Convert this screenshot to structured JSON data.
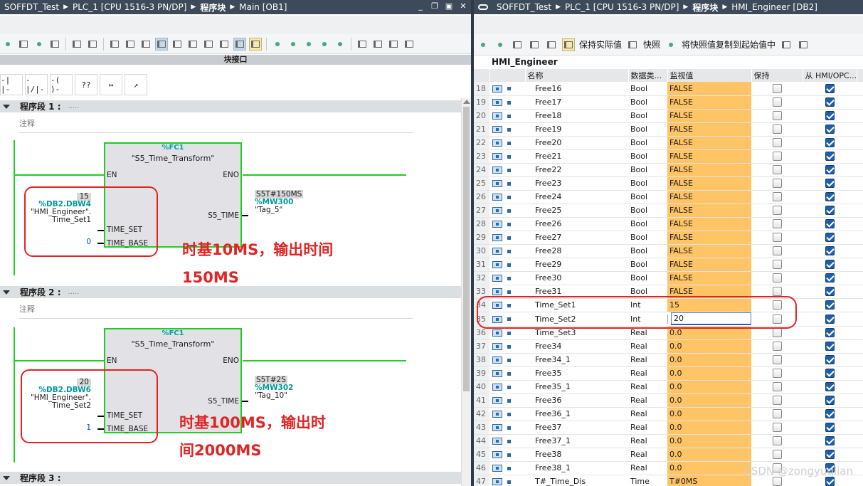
{
  "left_pane": {
    "breadcrumb": [
      "SOFFDT_Test",
      "PLC_1 [CPU 1516-3 PN/DP]",
      "程序块",
      "Main [OB1]"
    ],
    "block_interface_label": "块接口",
    "ladder_elements": [
      "-| |-",
      "-|/|-",
      "-( )-",
      "??",
      "↦",
      "↗"
    ],
    "networks": [
      {
        "label": "程序段 1 :",
        "dots": ".....",
        "comment": "注释",
        "fc_name": "%FC1",
        "fc_title": "\"S5_Time_Transform\"",
        "pin_en": "EN",
        "pin_eno": "ENO",
        "pin_time_set": "TIME_SET",
        "pin_time_base": "TIME_BASE",
        "pin_s5_time": "S5_TIME",
        "in_value": "15",
        "in_address": "%DB2.DBW4",
        "in_tag_line1": "\"HMI_Engineer\".",
        "in_tag_line2": "Time_Set1",
        "base_value": "0",
        "out_value": "S5T#150MS",
        "out_address": "%MW300",
        "out_tag": "\"Tag_5\"",
        "annotation_line1": "时基10MS，输出时间",
        "annotation_line2": "150MS"
      },
      {
        "label": "程序段 2 :",
        "dots": ".....",
        "comment": "注释",
        "fc_name": "%FC1",
        "fc_title": "\"S5_Time_Transform\"",
        "pin_en": "EN",
        "pin_eno": "ENO",
        "pin_time_set": "TIME_SET",
        "pin_time_base": "TIME_BASE",
        "pin_s5_time": "S5_TIME",
        "in_value": "20",
        "in_address": "%DB2.DBW6",
        "in_tag_line1": "\"HMI_Engineer\".",
        "in_tag_line2": "Time_Set2",
        "base_value": "1",
        "out_value": "S5T#2S",
        "out_address": "%MW302",
        "out_tag": "\"Tag_10\"",
        "annotation_line1": "时基100MS，输出时",
        "annotation_line2": "间2000MS"
      }
    ],
    "network3_label": "程序段 3 :"
  },
  "right_pane": {
    "breadcrumb": [
      "SOFFDT_Test",
      "PLC_1 [CPU 1516-3 PN/DP]",
      "程序块",
      "HMI_Engineer [DB2]"
    ],
    "toolbar_labels": [
      "保持实际值",
      "快照",
      "将快照值复制到起始值中"
    ],
    "db_name": "HMI_Engineer",
    "columns": [
      "名称",
      "数据类...",
      "监视值",
      "保持",
      "从 HMI/OPC..."
    ],
    "rows": [
      {
        "num": "18",
        "name": "Free16",
        "type": "Bool",
        "value": "FALSE"
      },
      {
        "num": "19",
        "name": "Free17",
        "type": "Bool",
        "value": "FALSE"
      },
      {
        "num": "20",
        "name": "Free18",
        "type": "Bool",
        "value": "FALSE"
      },
      {
        "num": "21",
        "name": "Free19",
        "type": "Bool",
        "value": "FALSE"
      },
      {
        "num": "22",
        "name": "Free20",
        "type": "Bool",
        "value": "FALSE"
      },
      {
        "num": "23",
        "name": "Free21",
        "type": "Bool",
        "value": "FALSE"
      },
      {
        "num": "24",
        "name": "Free22",
        "type": "Bool",
        "value": "FALSE"
      },
      {
        "num": "25",
        "name": "Free23",
        "type": "Bool",
        "value": "FALSE"
      },
      {
        "num": "26",
        "name": "Free24",
        "type": "Bool",
        "value": "FALSE"
      },
      {
        "num": "27",
        "name": "Free25",
        "type": "Bool",
        "value": "FALSE"
      },
      {
        "num": "28",
        "name": "Free26",
        "type": "Bool",
        "value": "FALSE"
      },
      {
        "num": "29",
        "name": "Free27",
        "type": "Bool",
        "value": "FALSE"
      },
      {
        "num": "30",
        "name": "Free28",
        "type": "Bool",
        "value": "FALSE"
      },
      {
        "num": "31",
        "name": "Free29",
        "type": "Bool",
        "value": "FALSE"
      },
      {
        "num": "32",
        "name": "Free30",
        "type": "Bool",
        "value": "FALSE"
      },
      {
        "num": "33",
        "name": "Free31",
        "type": "Bool",
        "value": "FALSE"
      },
      {
        "num": "34",
        "name": "Time_Set1",
        "type": "Int",
        "value": "15"
      },
      {
        "num": "35",
        "name": "Time_Set2",
        "type": "Int",
        "value": "20"
      },
      {
        "num": "36",
        "name": "Time_Set3",
        "type": "Real",
        "value": "0.0"
      },
      {
        "num": "37",
        "name": "Free34",
        "type": "Real",
        "value": "0.0"
      },
      {
        "num": "38",
        "name": "Free34_1",
        "type": "Real",
        "value": "0.0"
      },
      {
        "num": "39",
        "name": "Free35",
        "type": "Real",
        "value": "0.0"
      },
      {
        "num": "40",
        "name": "Free35_1",
        "type": "Real",
        "value": "0.0"
      },
      {
        "num": "41",
        "name": "Free36",
        "type": "Real",
        "value": "0.0"
      },
      {
        "num": "42",
        "name": "Free36_1",
        "type": "Real",
        "value": "0.0"
      },
      {
        "num": "43",
        "name": "Free37",
        "type": "Real",
        "value": "0.0"
      },
      {
        "num": "44",
        "name": "Free37_1",
        "type": "Real",
        "value": "0.0"
      },
      {
        "num": "45",
        "name": "Free38",
        "type": "Real",
        "value": "0.0"
      },
      {
        "num": "46",
        "name": "Free38_1",
        "type": "Real",
        "value": "0.0"
      },
      {
        "num": "47",
        "name": "T#_Time_Dis",
        "type": "Time",
        "value": "T#0MS"
      }
    ],
    "watermark": "CSDN @zongyuqlian"
  },
  "colors": {
    "title_bar": "#3c4a59",
    "wire_green": "#22cc22",
    "annotation_red": "#e02424",
    "monitor_orange": "#ffc466",
    "address_teal": "#009999"
  }
}
